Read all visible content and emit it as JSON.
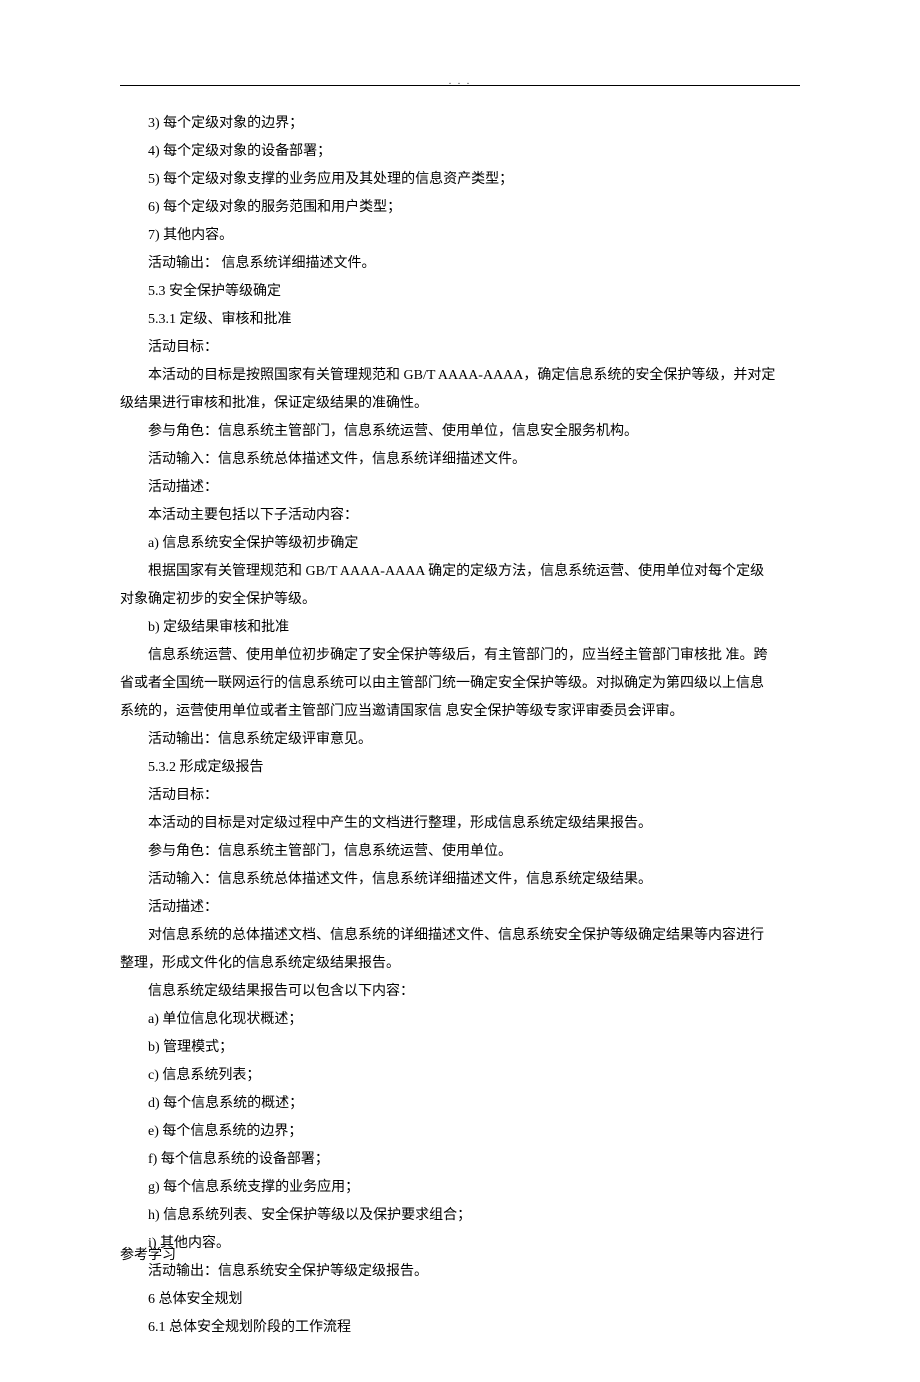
{
  "header": {
    "dots": ".    .                                        ."
  },
  "lines": [
    {
      "cls": "indent1",
      "text": "3)  每个定级对象的边界；"
    },
    {
      "cls": "indent1",
      "text": "4)  每个定级对象的设备部署；"
    },
    {
      "cls": "indent1",
      "text": "5)  每个定级对象支撑的业务应用及其处理的信息资产类型；"
    },
    {
      "cls": "indent1",
      "text": "6)  每个定级对象的服务范围和用户类型；"
    },
    {
      "cls": "indent1",
      "text": "7)  其他内容。"
    },
    {
      "cls": "indent1",
      "text": "活动输出：  信息系统详细描述文件。"
    },
    {
      "cls": "indent1",
      "text": "5.3  安全保护等级确定"
    },
    {
      "cls": "indent1",
      "text": "5.3.1     定级、审核和批准"
    },
    {
      "cls": "indent1",
      "text": "活动目标："
    },
    {
      "cls": "indent1",
      "text": "本活动的目标是按照国家有关管理规范和 GB/T AAAA-AAAA，确定信息系统的安全保护等级，并对定"
    },
    {
      "cls": "indent0",
      "text": "级结果进行审核和批准，保证定级结果的准确性。"
    },
    {
      "cls": "indent1",
      "text": "参与角色：信息系统主管部门，信息系统运营、使用单位，信息安全服务机构。"
    },
    {
      "cls": "indent1",
      "text": "活动输入：信息系统总体描述文件，信息系统详细描述文件。"
    },
    {
      "cls": "indent1",
      "text": "活动描述："
    },
    {
      "cls": "indent1",
      "text": "本活动主要包括以下子活动内容："
    },
    {
      "cls": "indent1",
      "text": "a)    信息系统安全保护等级初步确定"
    },
    {
      "cls": "indent1",
      "text": "根据国家有关管理规范和 GB/T AAAA-AAAA 确定的定级方法，信息系统运营、使用单位对每个定级"
    },
    {
      "cls": "indent0",
      "text": "对象确定初步的安全保护等级。"
    },
    {
      "cls": "indent1",
      "text": "b)    定级结果审核和批准"
    },
    {
      "cls": "indent1",
      "text": "信息系统运营、使用单位初步确定了安全保护等级后，有主管部门的，应当经主管部门审核批  准。跨"
    },
    {
      "cls": "indent0",
      "text": "省或者全国统一联网运行的信息系统可以由主管部门统一确定安全保护等级。对拟确定为第四级以上信息"
    },
    {
      "cls": "indent0",
      "text": "系统的，运营使用单位或者主管部门应当邀请国家信  息安全保护等级专家评审委员会评审。"
    },
    {
      "cls": "indent1",
      "text": "活动输出：信息系统定级评审意见。"
    },
    {
      "cls": "indent1",
      "text": "5.3.2     形成定级报告"
    },
    {
      "cls": "indent1",
      "text": "活动目标："
    },
    {
      "cls": "indent1",
      "text": "本活动的目标是对定级过程中产生的文档进行整理，形成信息系统定级结果报告。"
    },
    {
      "cls": "indent1",
      "text": "参与角色：信息系统主管部门，信息系统运营、使用单位。"
    },
    {
      "cls": "indent1",
      "text": "活动输入：信息系统总体描述文件，信息系统详细描述文件，信息系统定级结果。"
    },
    {
      "cls": "indent1",
      "text": "活动描述："
    },
    {
      "cls": "indent1",
      "text": "对信息系统的总体描述文档、信息系统的详细描述文件、信息系统安全保护等级确定结果等内容进行"
    },
    {
      "cls": "indent0",
      "text": "整理，形成文件化的信息系统定级结果报告。"
    },
    {
      "cls": "indent1",
      "text": "信息系统定级结果报告可以包含以下内容："
    },
    {
      "cls": "indent1",
      "text": "a)    单位信息化现状概述；"
    },
    {
      "cls": "indent1",
      "text": "b)    管理模式；"
    },
    {
      "cls": "indent1",
      "text": "c)    信息系统列表；"
    },
    {
      "cls": "indent1",
      "text": "d)    每个信息系统的概述；"
    },
    {
      "cls": "indent1",
      "text": "e)    每个信息系统的边界；"
    },
    {
      "cls": "indent1",
      "text": "f)    每个信息系统的设备部署；"
    },
    {
      "cls": "indent1",
      "text": "g)    每个信息系统支撑的业务应用；"
    },
    {
      "cls": "indent1",
      "text": "h)    信息系统列表、安全保护等级以及保护要求组合；"
    },
    {
      "cls": "indent1",
      "text": "i)    其他内容。"
    },
    {
      "cls": "indent1",
      "text": "活动输出：信息系统安全保护等级定级报告。"
    },
    {
      "cls": "indent1",
      "text": "6  总体安全规划"
    },
    {
      "cls": "indent1",
      "text": "6.1  总体安全规划阶段的工作流程"
    }
  ],
  "footer": {
    "text": "参考学习"
  }
}
